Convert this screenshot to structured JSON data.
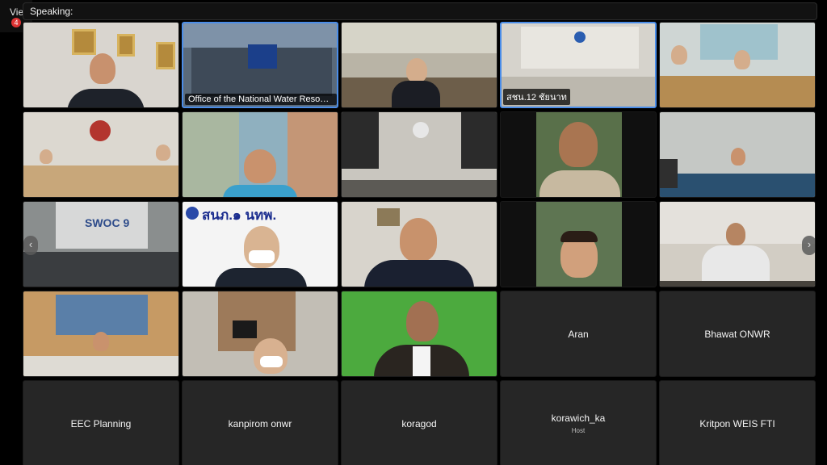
{
  "window": {
    "view_label": "Vie",
    "notification_badge": "4"
  },
  "speaking_bar": {
    "label": "Speaking:"
  },
  "tiles": [
    {
      "id": "r1c1",
      "label": "",
      "kind": "video"
    },
    {
      "id": "r1c2",
      "label": "Office of the National Water Resour...",
      "kind": "video",
      "active": true
    },
    {
      "id": "r1c3",
      "label": "",
      "kind": "video"
    },
    {
      "id": "r1c4",
      "label": "สชน.12 ชัยนาท",
      "kind": "video",
      "active": true
    },
    {
      "id": "r1c5",
      "label": "",
      "kind": "video"
    },
    {
      "id": "r2c1",
      "label": "",
      "kind": "video"
    },
    {
      "id": "r2c2",
      "label": "",
      "kind": "video"
    },
    {
      "id": "r2c3",
      "label": "",
      "kind": "video"
    },
    {
      "id": "r2c4",
      "label": "",
      "kind": "video"
    },
    {
      "id": "r2c5",
      "label": "",
      "kind": "video"
    },
    {
      "id": "r3c1",
      "label": "",
      "kind": "video"
    },
    {
      "id": "r3c2",
      "label": "",
      "kind": "video"
    },
    {
      "id": "r3c3",
      "label": "",
      "kind": "video"
    },
    {
      "id": "r3c4",
      "label": "",
      "kind": "video"
    },
    {
      "id": "r3c5",
      "label": "",
      "kind": "video"
    },
    {
      "id": "r4c1",
      "label": "",
      "kind": "video"
    },
    {
      "id": "r4c2",
      "label": "",
      "kind": "video"
    },
    {
      "id": "r4c3",
      "label": "",
      "kind": "video"
    },
    {
      "id": "r4c4",
      "label": "Aran",
      "kind": "name"
    },
    {
      "id": "r4c5",
      "label": "Bhawat ONWR",
      "kind": "name"
    },
    {
      "id": "r5c1",
      "label": "EEC Planning",
      "kind": "name"
    },
    {
      "id": "r5c2",
      "label": "kanpirom onwr",
      "kind": "name"
    },
    {
      "id": "r5c3",
      "label": "koragod",
      "kind": "name"
    },
    {
      "id": "r5c4",
      "label": "korawich_ka",
      "kind": "name",
      "role": "Host"
    },
    {
      "id": "r5c5",
      "label": "Kritpon WEIS FTI",
      "kind": "name"
    }
  ],
  "banners": {
    "r3c2_text": "สนภ.๑ นทพ.",
    "r3c1_text": "SWOC 9"
  },
  "navigation": {
    "prev_icon": "chevron-left-icon",
    "next_icon": "chevron-right-icon",
    "prev_glyph": "‹",
    "next_glyph": "›"
  },
  "colors": {
    "active_border": "#4b8de8",
    "tile_bg": "#262626",
    "badge": "#d33"
  }
}
